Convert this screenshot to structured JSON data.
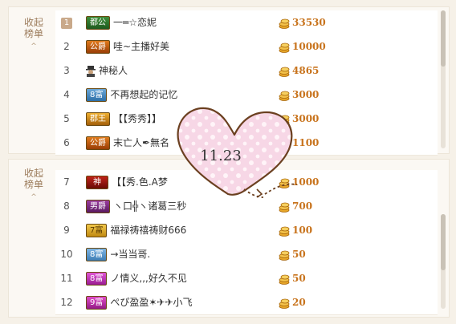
{
  "sections": {
    "top": {
      "collapse_label_line1": "收起",
      "collapse_label_line2": "榜单",
      "caret": "^"
    },
    "bottom": {
      "collapse_label_line1": "收起",
      "collapse_label_line2": "榜单",
      "caret": "^"
    }
  },
  "rows": [
    {
      "rank": "1",
      "badge": "都公",
      "name": "一═☆恋妮",
      "coins": "33530"
    },
    {
      "rank": "2",
      "badge": "公爵",
      "name": "哇~主播好美",
      "coins": "10000"
    },
    {
      "rank": "3",
      "badge": "",
      "name": "神秘人",
      "coins": "4865"
    },
    {
      "rank": "4",
      "badge": "8富",
      "name": "不再想起的记忆",
      "coins": "3000"
    },
    {
      "rank": "5",
      "badge": "郡王",
      "name": "【【秀秀】】",
      "coins": "3000"
    },
    {
      "rank": "6",
      "badge": "公爵",
      "name": "末亡人✒無名",
      "coins": "1100"
    },
    {
      "rank": "7",
      "badge": "神",
      "name": "【【秀.色.A梦",
      "coins": "1000"
    },
    {
      "rank": "8",
      "badge": "男爵",
      "name": "ヽ口╬ヽ诸葛三秒",
      "coins": "700"
    },
    {
      "rank": "9",
      "badge": "7富",
      "name": "福禄祷禧祷财666",
      "coins": "100"
    },
    {
      "rank": "10",
      "badge": "8富",
      "name": "→当当哥.",
      "coins": "50"
    },
    {
      "rank": "11",
      "badge": "8富",
      "name": "ノ情义,,,好久不见",
      "coins": "50"
    },
    {
      "rank": "12",
      "badge": "9富",
      "name": "ぺぴ盈盈✶✈✈小飞",
      "coins": "20"
    }
  ],
  "overlay": {
    "heart_text": "11.23",
    "heart_icon": "heart-icon"
  },
  "colors": {
    "coin": "#c8731c",
    "heart_fill": "#f7d7e6",
    "heart_stroke": "#6b4020"
  }
}
